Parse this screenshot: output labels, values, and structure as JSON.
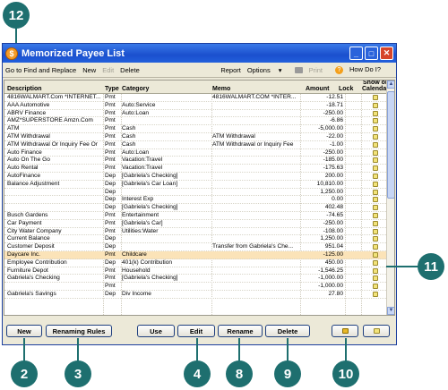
{
  "window": {
    "title": "Memorized Payee List"
  },
  "toolbar": {
    "find_replace": "Go to Find and Replace",
    "new": "New",
    "edit": "Edit",
    "delete": "Delete",
    "report": "Report",
    "options": "Options",
    "print": "Print",
    "how_do_i": "How Do I?"
  },
  "columns": {
    "description": "Description",
    "type": "Type",
    "category": "Category",
    "memo": "Memo",
    "amount": "Amount",
    "lock": "Lock",
    "show_on_calendar_1": "Show on",
    "show_on_calendar_2": "Calendar"
  },
  "rows": [
    {
      "description": "4816WALMART.Com *INTERNET...",
      "type": "Pmt",
      "category": "",
      "memo": "4816WALMART.COM *INTER...",
      "amount": "-12.51",
      "cal": true
    },
    {
      "description": "AAA Automotive",
      "type": "Pmt",
      "category": "Auto:Service",
      "memo": "",
      "amount": "-18.71",
      "cal": true
    },
    {
      "description": "ABRV Finance",
      "type": "Pmt",
      "category": "Auto:Loan",
      "memo": "",
      "amount": "-250.00",
      "cal": true
    },
    {
      "description": "AMZ*SUPERSTORE        Amzn.Com",
      "type": "Pmt",
      "category": "",
      "memo": "",
      "amount": "-6.86",
      "cal": true
    },
    {
      "description": "ATM",
      "type": "Pmt",
      "category": "Cash",
      "memo": "",
      "amount": "-5,000.00",
      "cal": true
    },
    {
      "description": "ATM Withdrawal",
      "type": "Pmt",
      "category": "Cash",
      "memo": "ATM Withdrawal",
      "amount": "-22.00",
      "cal": true
    },
    {
      "description": "ATM Withdrawal Or Inquiry Fee Or",
      "type": "Pmt",
      "category": "Cash",
      "memo": "ATM Withdrawal or Inquiry Fee",
      "amount": "-1.00",
      "cal": true
    },
    {
      "description": "Auto Finance",
      "type": "Pmt",
      "category": "Auto:Loan",
      "memo": "",
      "amount": "-250.00",
      "cal": true
    },
    {
      "description": "Auto On The Go",
      "type": "Pmt",
      "category": "Vacation:Travel",
      "memo": "",
      "amount": "-185.00",
      "cal": true
    },
    {
      "description": "Auto Rental",
      "type": "Pmt",
      "category": "Vacation:Travel",
      "memo": "",
      "amount": "-175.63",
      "cal": true
    },
    {
      "description": "AutoFinance",
      "type": "Dep",
      "category": "[Gabriela's Checking]",
      "memo": "",
      "amount": "200.00",
      "cal": true
    },
    {
      "description": "Balance Adjustment",
      "type": "Dep",
      "category": "[Gabriela's Car Loan]",
      "memo": "",
      "amount": "10,810.00",
      "cal": true
    },
    {
      "description": "",
      "type": "Dep",
      "category": "",
      "memo": "",
      "amount": "1,250.00",
      "cal": true
    },
    {
      "description": "",
      "type": "Dep",
      "category": "Interest Exp",
      "memo": "",
      "amount": "0.00",
      "cal": true
    },
    {
      "description": "",
      "type": "Dep",
      "category": "[Gabriela's Checking]",
      "memo": "",
      "amount": "402.48",
      "cal": true
    },
    {
      "description": "Busch Gardens",
      "type": "Pmt",
      "category": "Entertainment",
      "memo": "",
      "amount": "-74.65",
      "cal": true
    },
    {
      "description": "Car Payment",
      "type": "Pmt",
      "category": "[Gabriela's Car]",
      "memo": "",
      "amount": "-250.00",
      "cal": true
    },
    {
      "description": "City Water Company",
      "type": "Pmt",
      "category": "Utilities:Water",
      "memo": "",
      "amount": "-108.00",
      "cal": true
    },
    {
      "description": "Current Balance",
      "type": "Dep",
      "category": "",
      "memo": "",
      "amount": "1,250.00",
      "cal": true
    },
    {
      "description": "Customer Deposit",
      "type": "Dep",
      "category": "",
      "memo": "Transfer from Gabriela's Che...",
      "amount": "951.04",
      "cal": true
    },
    {
      "description": "Daycare Inc.",
      "type": "Pmt",
      "category": "Childcare",
      "memo": "",
      "amount": "-125.00",
      "cal": true,
      "highlight": true
    },
    {
      "description": "Employee Contribution",
      "type": "Dep",
      "category": "401(k) Contribution",
      "memo": "",
      "amount": "450.00",
      "cal": true
    },
    {
      "description": "Furniture Depot",
      "type": "Pmt",
      "category": "Household",
      "memo": "",
      "amount": "-1,546.25",
      "cal": true
    },
    {
      "description": "Gabriela's Checking",
      "type": "Pmt",
      "category": "[Gabriela's Checking]",
      "memo": "",
      "amount": "-1,000.00",
      "cal": true
    },
    {
      "description": "",
      "type": "Pmt",
      "category": "",
      "memo": "",
      "amount": "-1,000.00",
      "cal": true
    },
    {
      "description": "Gabriela's Savings",
      "type": "Dep",
      "category": "Div Income",
      "memo": "",
      "amount": "27.80",
      "cal": true
    }
  ],
  "buttons": {
    "new": "New",
    "renaming_rules": "Renaming Rules",
    "use": "Use",
    "edit": "Edit",
    "rename": "Rename",
    "delete": "Delete"
  },
  "callouts": {
    "c12": "12",
    "c11": "11",
    "c2": "2",
    "c3": "3",
    "c4": "4",
    "c8": "8",
    "c9": "9",
    "c10": "10"
  },
  "colors": {
    "callout": "#1e6f6f",
    "titlebar": "#1a4fce",
    "highlight_row": "#fbe3b8"
  }
}
